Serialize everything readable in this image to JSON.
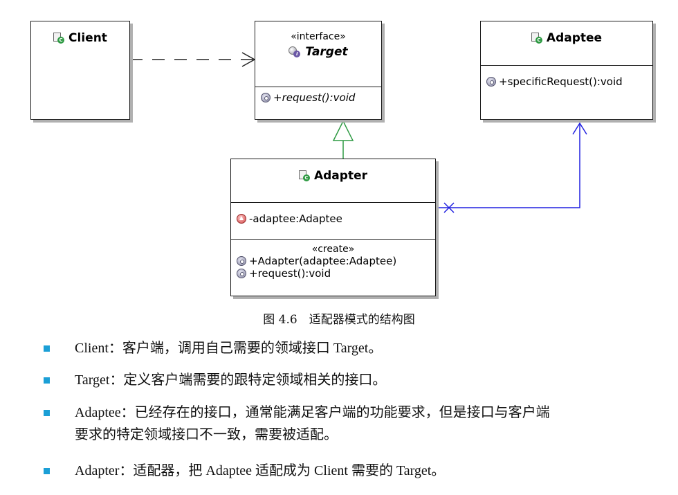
{
  "diagram": {
    "client": {
      "name": "Client"
    },
    "target": {
      "stereotype": "«interface»",
      "name": "Target",
      "operations": [
        "+request():void"
      ]
    },
    "adaptee": {
      "name": "Adaptee",
      "operations": [
        "+specificRequest():void"
      ]
    },
    "adapter": {
      "name": "Adapter",
      "attributes": [
        "-adaptee:Adaptee"
      ],
      "stereotype": "«create»",
      "operations": [
        "+Adapter(adaptee:Adaptee)",
        "+request():void"
      ]
    },
    "icons": {
      "class": "class-icon",
      "interface": "interface-icon",
      "public_method": "public-method-icon",
      "private_field": "private-field-icon"
    },
    "colors": {
      "generalization": "#2e9a43",
      "association": "#2020e0",
      "dependency": "#222222"
    }
  },
  "caption": "图 4.6　适配器模式的结构图",
  "bullets": [
    {
      "term": "Client",
      "text": "：客户端，调用自己需要的领域接口 Target。"
    },
    {
      "term": "Target",
      "text": "：定义客户端需要的跟特定领域相关的接口。"
    },
    {
      "term": "Adaptee",
      "text": "：已经存在的接口，通常能满足客户端的功能要求，但是接口与客户端",
      "continuation": "要求的特定领域接口不一致，需要被适配。"
    },
    {
      "term": "Adapter",
      "text": "：适配器，把 Adaptee 适配成为 Client 需要的 Target。"
    }
  ]
}
